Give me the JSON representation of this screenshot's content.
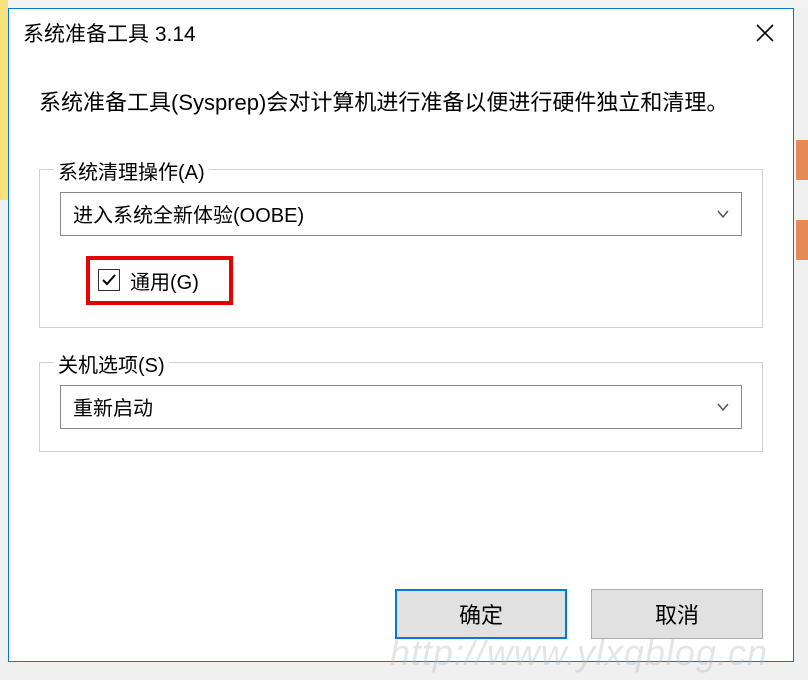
{
  "dialog": {
    "title": "系统准备工具 3.14",
    "description": "系统准备工具(Sysprep)会对计算机进行准备以便进行硬件独立和清理。",
    "cleanup_group": {
      "legend": "系统清理操作(A)",
      "dropdown_value": "进入系统全新体验(OOBE)",
      "generalize_label": "通用(G)",
      "generalize_checked": true
    },
    "shutdown_group": {
      "legend": "关机选项(S)",
      "dropdown_value": "重新启动"
    },
    "buttons": {
      "ok": "确定",
      "cancel": "取消"
    }
  },
  "watermark": "http://www.ylxqblog.cn"
}
